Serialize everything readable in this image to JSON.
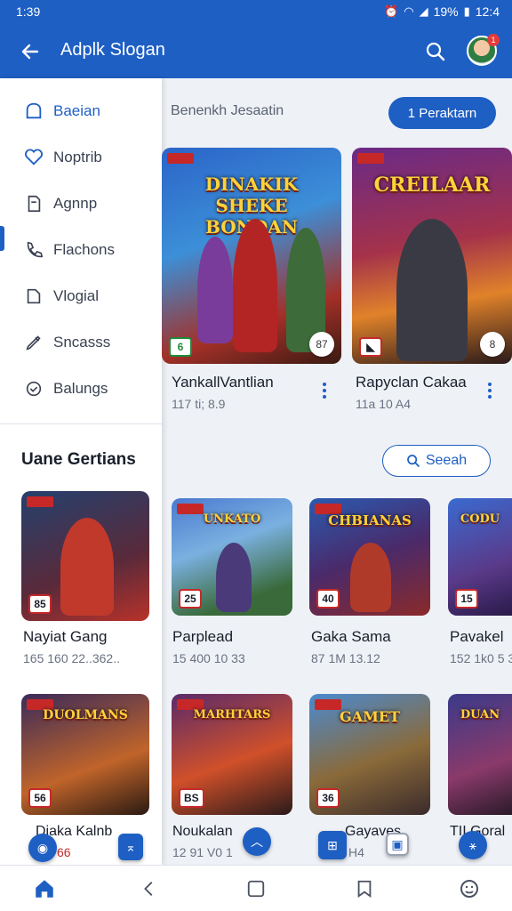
{
  "status_bar": {
    "time": "1:39",
    "battery": "19%",
    "clock_right": "12:4"
  },
  "app_bar": {
    "title": "Adplk Slogan",
    "notification_count": "1"
  },
  "drawer": {
    "items": [
      {
        "label": "Baeian",
        "icon": "home-outline-icon"
      },
      {
        "label": "Noptrib",
        "icon": "heart-icon"
      },
      {
        "label": "Agnnp",
        "icon": "document-icon"
      },
      {
        "label": "Flachons",
        "icon": "phone-icon"
      },
      {
        "label": "Vlogial",
        "icon": "folder-icon"
      },
      {
        "label": "Sncasss",
        "icon": "pen-icon"
      },
      {
        "label": "Balungs",
        "icon": "shield-check-icon"
      }
    ],
    "section_title": "Uane Gertians"
  },
  "content": {
    "heading": "Benenkh Jesaatin",
    "primary_button": "1 Peraktarn",
    "secondary_button": "Seeah"
  },
  "featured": [
    {
      "name": "YankallVantlian",
      "meta": "117 ti; 8.9",
      "art_title": "DINAKIK SHEKE BONDAN",
      "badge": "6",
      "share": "87"
    },
    {
      "name": "Rapyclan Cakaa",
      "meta": "11a 10 A4",
      "art_title": "CREILAAR",
      "badge": "◣",
      "share": "8"
    }
  ],
  "grid_row1": [
    {
      "name": "Nayiat Gang",
      "meta": "165 160 22..362..",
      "art_title": "",
      "badge": "85"
    },
    {
      "name": "Parplead",
      "meta": "15 400 10 33",
      "art_title": "UNKATO",
      "badge": "25"
    },
    {
      "name": "Gaka Sama",
      "meta": "87 1M 13.12",
      "art_title": "CHBIANAS",
      "badge": "40"
    },
    {
      "name": "Pavakel",
      "meta": "152 1k0 5 3",
      "art_title": "CODU",
      "badge": "15"
    }
  ],
  "grid_row2": [
    {
      "name": "Diaka Kalnb",
      "meta": "66",
      "art_title": "DUOLMANS",
      "badge": "56"
    },
    {
      "name": "Noukalan",
      "meta": "12 91 V0 1",
      "art_title": "MARHTARS",
      "badge": "BS"
    },
    {
      "name": "Gayaves",
      "meta": "H4",
      "art_title": "GAMET",
      "badge": "36"
    },
    {
      "name": "TII Goral",
      "meta": "",
      "art_title": "DUAN",
      "badge": ""
    }
  ],
  "colors": {
    "primary": "#1e5fc4",
    "surface": "#ffffff",
    "background": "#eef1f6"
  },
  "bottom_nav": [
    "home-icon",
    "back-chevron-icon",
    "square-icon",
    "bookmark-icon",
    "emoji-icon"
  ]
}
